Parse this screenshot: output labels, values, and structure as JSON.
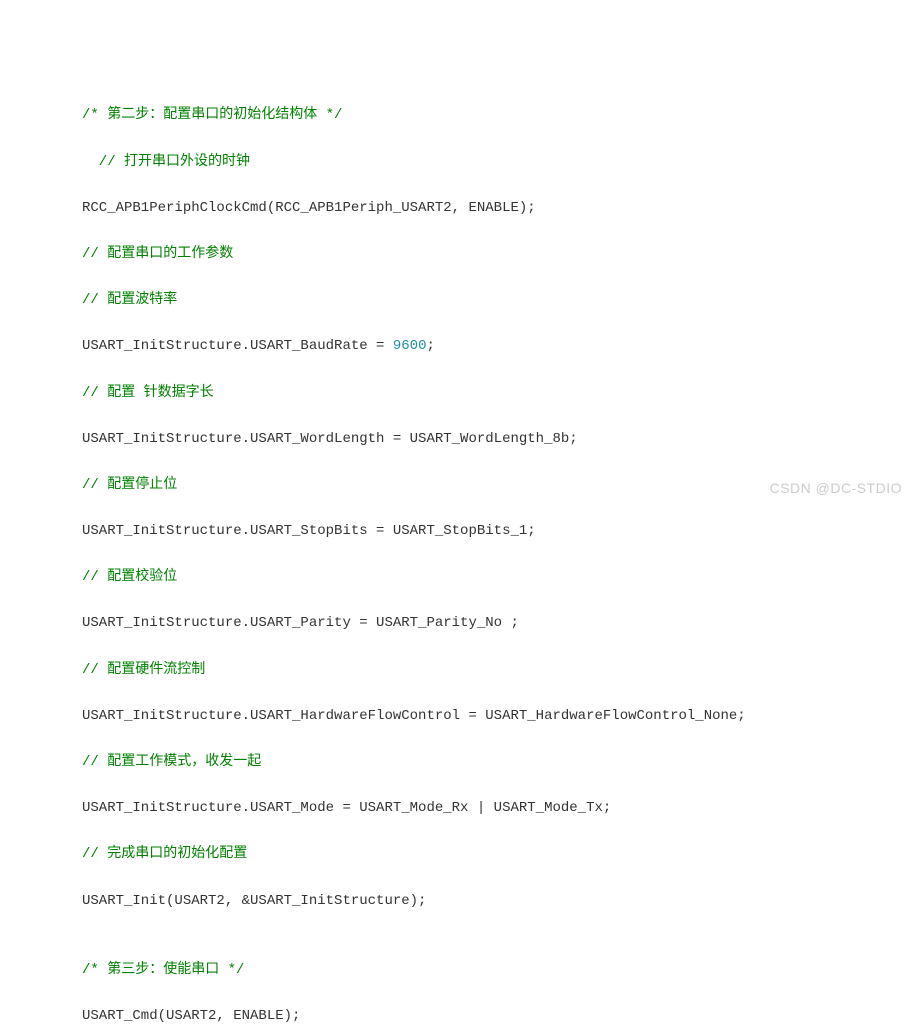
{
  "code": {
    "l1": "/* 第二步：配置串口的初始化结构体 */",
    "l2": "  // 打开串口外设的时钟",
    "l3": "RCC_APB1PeriphClockCmd(RCC_APB1Periph_USART2, ENABLE);",
    "l4": "// 配置串口的工作参数",
    "l5": "// 配置波特率",
    "l6a": "USART_InitStructure.USART_BaudRate = ",
    "l6b": "9600",
    "l6c": ";",
    "l7": "// 配置 针数据字长",
    "l8": "USART_InitStructure.USART_WordLength = USART_WordLength_8b;",
    "l9": "// 配置停止位",
    "l10": "USART_InitStructure.USART_StopBits = USART_StopBits_1;",
    "l11": "// 配置校验位",
    "l12": "USART_InitStructure.USART_Parity = USART_Parity_No ;",
    "l13": "// 配置硬件流控制",
    "l14": "USART_InitStructure.USART_HardwareFlowControl = USART_HardwareFlowControl_None;",
    "l15": "// 配置工作模式，收发一起",
    "l16": "USART_InitStructure.USART_Mode = USART_Mode_Rx | USART_Mode_Tx;",
    "l17": "// 完成串口的初始化配置",
    "l18": "USART_Init(USART2, &USART_InitStructure);",
    "l19": "",
    "l20": "/* 第三步：使能串口 */",
    "l21": "USART_Cmd(USART2, ENABLE);"
  },
  "watermark": "CSDN @DC-STDIO"
}
